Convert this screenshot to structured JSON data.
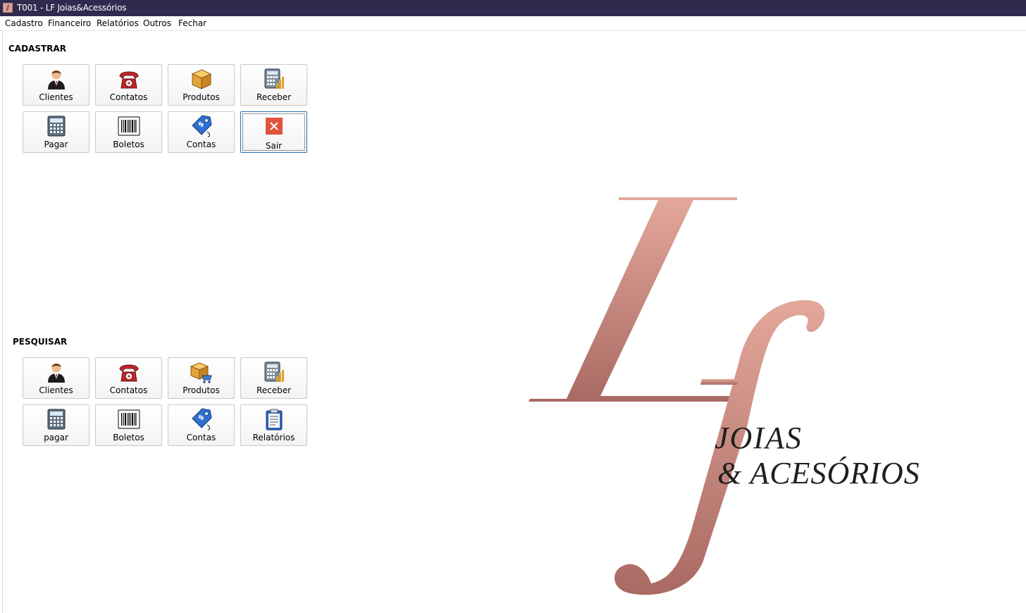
{
  "window": {
    "title": "T001 - LF Joias&Acessórios"
  },
  "menu": [
    "Cadastro",
    "Financeiro",
    "Relatórios",
    "Outros",
    "Fechar"
  ],
  "cadastrar": {
    "title": "CADASTRAR",
    "buttons": [
      {
        "label": "Clientes",
        "icon": "person-icon"
      },
      {
        "label": "Contatos",
        "icon": "telephone-icon"
      },
      {
        "label": "Produtos",
        "icon": "box-icon"
      },
      {
        "label": "Receber",
        "icon": "calculator-chart-icon"
      },
      {
        "label": "Pagar",
        "icon": "calculator-icon"
      },
      {
        "label": "Boletos",
        "icon": "barcode-icon"
      },
      {
        "label": "Contas",
        "icon": "price-tag-icon"
      },
      {
        "label": "Sair",
        "icon": "close-icon"
      }
    ]
  },
  "pesquisar": {
    "title": "PESQUISAR",
    "buttons": [
      {
        "label": "Clientes",
        "icon": "person-icon"
      },
      {
        "label": "Contatos",
        "icon": "telephone-icon"
      },
      {
        "label": "Produtos",
        "icon": "box-cart-icon"
      },
      {
        "label": "Receber",
        "icon": "calculator-chart-icon"
      },
      {
        "label": "pagar",
        "icon": "calculator-icon"
      },
      {
        "label": "Boletos",
        "icon": "barcode-icon"
      },
      {
        "label": "Contas",
        "icon": "price-tag-icon"
      },
      {
        "label": "Relatórios",
        "icon": "clipboard-icon"
      }
    ]
  },
  "logo": {
    "monogram": "Lf",
    "line1": "JOIAS",
    "line2": "& ACESÓRIOS",
    "color": "#c58a80"
  },
  "colors": {
    "titlebar": "#2f2b4f",
    "focus_border": "#2f6fb3",
    "close_red": "#e0533c"
  }
}
